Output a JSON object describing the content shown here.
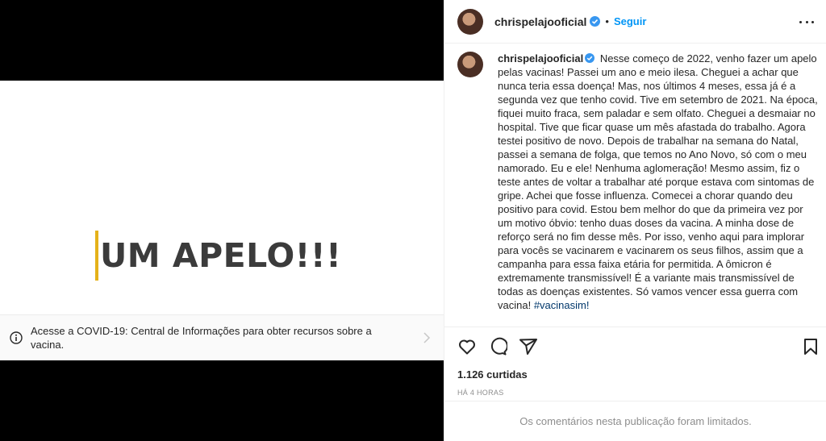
{
  "media": {
    "headline": "UM APELO!!!",
    "accent_color": "#e5b21a",
    "covid_banner": {
      "icon": "info-icon",
      "text": "Acesse a COVID-19: Central de Informações para obter recursos sobre a vacina.",
      "chevron": "chevron-right-icon"
    }
  },
  "header": {
    "username": "chrispelajooficial",
    "verified": true,
    "separator": "•",
    "follow_label": "Seguir",
    "follow_color": "#0095f6",
    "more_icon": "more-options-icon"
  },
  "caption": {
    "username": "chrispelajooficial",
    "text": " Nesse começo de 2022, venho fazer um apelo pelas vacinas! Passei um ano e meio ilesa. Cheguei a achar que nunca teria essa doença! Mas, nos últimos 4 meses, essa já é a segunda vez que tenho covid. Tive em setembro de 2021. Na época, fiquei muito fraca, sem paladar e sem olfato. Cheguei a desmaiar no hospital. Tive que ficar quase um mês afastada do trabalho. Agora testei positivo de novo. Depois de trabalhar na semana do Natal, passei a semana de folga, que temos no Ano Novo, só com o meu namorado. Eu e ele! Nenhuma aglomeração! Mesmo assim, fiz o teste antes de voltar a trabalhar até porque estava com sintomas de gripe. Achei que fosse influenza. Comecei a chorar quando deu positivo para covid. Estou bem melhor do que da primeira vez por um motivo óbvio: tenho duas doses da vacina. A minha dose de reforço será no fim desse mês. Por isso, venho aqui para implorar para vocês se vacinarem e vacinarem os seus filhos, assim que a campanha para essa faixa etária for permitida. A ômicron é extremamente transmissível! É a variante mais transmissível de todas as doenças existentes. Só vamos vencer essa guerra com vacina! ",
    "hashtag": "#vacinasim!"
  },
  "actions": {
    "like_icon": "heart-icon",
    "comment_icon": "comment-icon",
    "share_icon": "share-icon",
    "save_icon": "bookmark-icon"
  },
  "stats": {
    "likes": "1.126 curtidas",
    "timestamp": "HÁ 4 HORAS"
  },
  "comments": {
    "limited_text": "Os comentários nesta publicação foram limitados."
  }
}
